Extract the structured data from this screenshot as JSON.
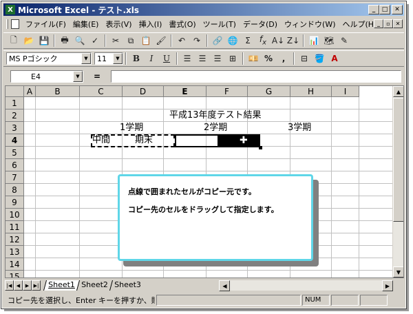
{
  "window": {
    "title": "Microsoft Excel - テスト.xls",
    "app_icon": "excel-icon"
  },
  "menu": [
    "ファイル(F)",
    "編集(E)",
    "表示(V)",
    "挿入(I)",
    "書式(O)",
    "ツール(T)",
    "データ(D)",
    "ウィンドウ(W)",
    "ヘルプ(H)"
  ],
  "toolbar_icons": [
    "new-icon",
    "open-icon",
    "save-icon",
    "print-icon",
    "print-preview-icon",
    "spelling-icon",
    "cut-icon",
    "copy-icon",
    "paste-icon",
    "format-painter-icon",
    "undo-icon",
    "redo-icon",
    "hyperlink-icon",
    "web-icon",
    "autosum-icon",
    "function-icon",
    "sort-asc-icon",
    "sort-desc-icon",
    "chart-wizard-icon",
    "map-icon",
    "drawing-icon"
  ],
  "format": {
    "font_name": "MS Pゴシック",
    "font_size": "11",
    "bold": "B",
    "italic": "I",
    "underline": "U",
    "percent": "%",
    "comma": ","
  },
  "formula_bar": {
    "name_box": "E4",
    "equals": "="
  },
  "columns": [
    "A",
    "B",
    "C",
    "D",
    "E",
    "F",
    "G",
    "H",
    "I"
  ],
  "rows": [
    "1",
    "2",
    "3",
    "4",
    "5",
    "6",
    "7",
    "8",
    "9",
    "10",
    "11",
    "12",
    "13",
    "14",
    "15"
  ],
  "active": {
    "column": "E",
    "row": "4"
  },
  "cells": {
    "D2": "平成13年度テスト結果",
    "C3": "1学期",
    "E3": "2学期",
    "G3": "3学期",
    "B4": "中間",
    "D4": "期末"
  },
  "callout": {
    "line1": "点線で囲まれたセルがコピー元です。",
    "line2": "コピー先のセルをドラッグして指定します。",
    "border_color": "#5fd6e8"
  },
  "sheet_tabs": [
    "Sheet1",
    "Sheet2",
    "Sheet3"
  ],
  "active_tab": "Sheet1",
  "status": {
    "message": "コピー先を選択し、Enter キーを押すか、貼",
    "num": "NUM"
  },
  "colors": {
    "titlebar_start": "#0a246a",
    "titlebar_end": "#a6caf0",
    "chrome": "#d4d0c8"
  }
}
